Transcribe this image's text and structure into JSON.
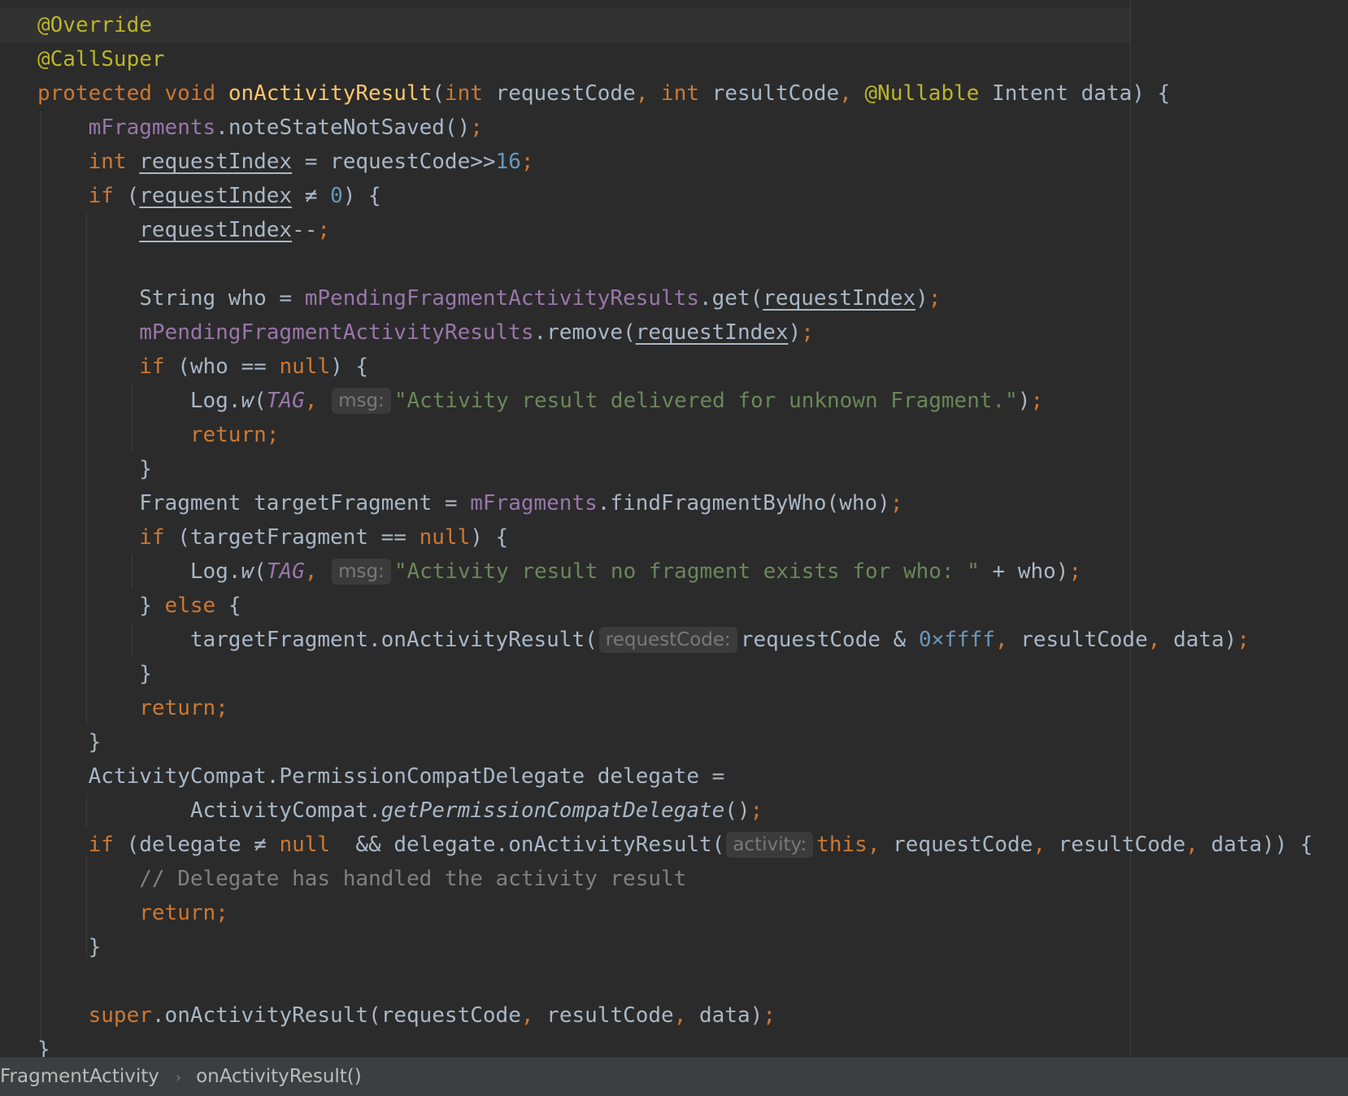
{
  "editor": {
    "lines": [
      [
        {
          "t": "@Override",
          "c": "ann"
        }
      ],
      [
        {
          "t": "@CallSuper",
          "c": "ann"
        }
      ],
      [
        {
          "t": "protected void ",
          "c": "kw"
        },
        {
          "t": "onActivityResult",
          "c": "fn"
        },
        {
          "t": "(",
          "c": "plain"
        },
        {
          "t": "int ",
          "c": "kw"
        },
        {
          "t": "requestCode",
          "c": "plain"
        },
        {
          "t": ", ",
          "c": "punc"
        },
        {
          "t": "int ",
          "c": "kw"
        },
        {
          "t": "resultCode",
          "c": "plain"
        },
        {
          "t": ", ",
          "c": "punc"
        },
        {
          "t": "@Nullable ",
          "c": "ann"
        },
        {
          "t": "Intent data) {",
          "c": "plain"
        }
      ],
      [
        {
          "t": "    ",
          "c": "indent"
        },
        {
          "t": "mFragments",
          "c": "field"
        },
        {
          "t": ".noteStateNotSaved()",
          "c": "plain"
        },
        {
          "t": ";",
          "c": "punc"
        }
      ],
      [
        {
          "t": "    ",
          "c": "indent"
        },
        {
          "t": "int ",
          "c": "kw"
        },
        {
          "t": "requestIndex",
          "c": "var-underline"
        },
        {
          "t": " = requestCode>>",
          "c": "plain"
        },
        {
          "t": "16",
          "c": "num"
        },
        {
          "t": ";",
          "c": "punc"
        }
      ],
      [
        {
          "t": "    ",
          "c": "indent"
        },
        {
          "t": "if ",
          "c": "kw"
        },
        {
          "t": "(",
          "c": "plain"
        },
        {
          "t": "requestIndex",
          "c": "var-underline"
        },
        {
          "t": " ≠ ",
          "c": "plain"
        },
        {
          "t": "0",
          "c": "num"
        },
        {
          "t": ") {",
          "c": "plain"
        }
      ],
      [
        {
          "t": "        ",
          "c": "indent"
        },
        {
          "t": "requestIndex",
          "c": "var-underline"
        },
        {
          "t": "--",
          "c": "plain"
        },
        {
          "t": ";",
          "c": "punc"
        }
      ],
      [],
      [
        {
          "t": "        ",
          "c": "indent"
        },
        {
          "t": "String who = ",
          "c": "plain"
        },
        {
          "t": "mPendingFragmentActivityResults",
          "c": "field"
        },
        {
          "t": ".get(",
          "c": "plain"
        },
        {
          "t": "requestIndex",
          "c": "var-underline"
        },
        {
          "t": ")",
          "c": "plain"
        },
        {
          "t": ";",
          "c": "punc"
        }
      ],
      [
        {
          "t": "        ",
          "c": "indent"
        },
        {
          "t": "mPendingFragmentActivityResults",
          "c": "field"
        },
        {
          "t": ".remove(",
          "c": "plain"
        },
        {
          "t": "requestIndex",
          "c": "var-underline"
        },
        {
          "t": ")",
          "c": "plain"
        },
        {
          "t": ";",
          "c": "punc"
        }
      ],
      [
        {
          "t": "        ",
          "c": "indent"
        },
        {
          "t": "if ",
          "c": "kw"
        },
        {
          "t": "(who == ",
          "c": "plain"
        },
        {
          "t": "null",
          "c": "kw"
        },
        {
          "t": ") {",
          "c": "plain"
        }
      ],
      [
        {
          "t": "            ",
          "c": "indent"
        },
        {
          "t": "Log.",
          "c": "plain"
        },
        {
          "t": "w",
          "c": "static-fn"
        },
        {
          "t": "(",
          "c": "plain"
        },
        {
          "t": "TAG",
          "c": "stat"
        },
        {
          "t": ", ",
          "c": "punc"
        },
        {
          "hint": "msg:"
        },
        {
          "t": "\"Activity result delivered for unknown Fragment.\"",
          "c": "str"
        },
        {
          "t": ")",
          "c": "plain"
        },
        {
          "t": ";",
          "c": "punc"
        }
      ],
      [
        {
          "t": "            ",
          "c": "indent"
        },
        {
          "t": "return;",
          "c": "kw"
        }
      ],
      [
        {
          "t": "        ",
          "c": "indent"
        },
        {
          "t": "}",
          "c": "plain"
        }
      ],
      [
        {
          "t": "        ",
          "c": "indent"
        },
        {
          "t": "Fragment targetFragment = ",
          "c": "plain"
        },
        {
          "t": "mFragments",
          "c": "field"
        },
        {
          "t": ".findFragmentByWho(who)",
          "c": "plain"
        },
        {
          "t": ";",
          "c": "punc"
        }
      ],
      [
        {
          "t": "        ",
          "c": "indent"
        },
        {
          "t": "if ",
          "c": "kw"
        },
        {
          "t": "(targetFragment == ",
          "c": "plain"
        },
        {
          "t": "null",
          "c": "kw"
        },
        {
          "t": ") {",
          "c": "plain"
        }
      ],
      [
        {
          "t": "            ",
          "c": "indent"
        },
        {
          "t": "Log.",
          "c": "plain"
        },
        {
          "t": "w",
          "c": "static-fn"
        },
        {
          "t": "(",
          "c": "plain"
        },
        {
          "t": "TAG",
          "c": "stat"
        },
        {
          "t": ", ",
          "c": "punc"
        },
        {
          "hint": "msg:"
        },
        {
          "t": "\"Activity result no fragment exists for who: \"",
          "c": "str"
        },
        {
          "t": " + who)",
          "c": "plain"
        },
        {
          "t": ";",
          "c": "punc"
        }
      ],
      [
        {
          "t": "        ",
          "c": "indent"
        },
        {
          "t": "} ",
          "c": "plain"
        },
        {
          "t": "else ",
          "c": "kw"
        },
        {
          "t": "{",
          "c": "plain"
        }
      ],
      [
        {
          "t": "            ",
          "c": "indent"
        },
        {
          "t": "targetFragment.onActivityResult(",
          "c": "plain"
        },
        {
          "hint": "requestCode:"
        },
        {
          "t": "requestCode & ",
          "c": "plain"
        },
        {
          "t": "0×ffff",
          "c": "num"
        },
        {
          "t": ", ",
          "c": "punc"
        },
        {
          "t": "resultCode",
          "c": "plain"
        },
        {
          "t": ", ",
          "c": "punc"
        },
        {
          "t": "data)",
          "c": "plain"
        },
        {
          "t": ";",
          "c": "punc"
        }
      ],
      [
        {
          "t": "        ",
          "c": "indent"
        },
        {
          "t": "}",
          "c": "plain"
        }
      ],
      [
        {
          "t": "        ",
          "c": "indent"
        },
        {
          "t": "return;",
          "c": "kw"
        }
      ],
      [
        {
          "t": "    ",
          "c": "indent"
        },
        {
          "t": "}",
          "c": "plain"
        }
      ],
      [
        {
          "t": "    ",
          "c": "indent"
        },
        {
          "t": "ActivityCompat.PermissionCompatDelegate delegate =",
          "c": "plain"
        }
      ],
      [
        {
          "t": "            ",
          "c": "indent"
        },
        {
          "t": "ActivityCompat.",
          "c": "plain"
        },
        {
          "t": "getPermissionCompatDelegate",
          "c": "static-fn"
        },
        {
          "t": "()",
          "c": "plain"
        },
        {
          "t": ";",
          "c": "punc"
        }
      ],
      [
        {
          "t": "    ",
          "c": "indent"
        },
        {
          "t": "if ",
          "c": "kw"
        },
        {
          "t": "(delegate ≠ ",
          "c": "plain"
        },
        {
          "t": "null ",
          "c": "kw"
        },
        {
          "t": " && delegate.onActivityResult(",
          "c": "plain"
        },
        {
          "hint": "activity:"
        },
        {
          "t": "this",
          "c": "kw"
        },
        {
          "t": ", ",
          "c": "punc"
        },
        {
          "t": "requestCode",
          "c": "plain"
        },
        {
          "t": ", ",
          "c": "punc"
        },
        {
          "t": "resultCode",
          "c": "plain"
        },
        {
          "t": ", ",
          "c": "punc"
        },
        {
          "t": "data)) {",
          "c": "plain"
        }
      ],
      [
        {
          "t": "        ",
          "c": "indent"
        },
        {
          "t": "// Delegate has handled the activity result",
          "c": "cmt"
        }
      ],
      [
        {
          "t": "        ",
          "c": "indent"
        },
        {
          "t": "return;",
          "c": "kw"
        }
      ],
      [
        {
          "t": "    ",
          "c": "indent"
        },
        {
          "t": "}",
          "c": "plain"
        }
      ],
      [],
      [
        {
          "t": "    ",
          "c": "indent"
        },
        {
          "t": "super",
          "c": "kw"
        },
        {
          "t": ".onActivityResult(requestCode",
          "c": "plain"
        },
        {
          "t": ", ",
          "c": "punc"
        },
        {
          "t": "resultCode",
          "c": "plain"
        },
        {
          "t": ", ",
          "c": "punc"
        },
        {
          "t": "data)",
          "c": "plain"
        },
        {
          "t": ";",
          "c": "punc"
        }
      ],
      [
        {
          "t": "}",
          "c": "plain"
        }
      ]
    ]
  },
  "breadcrumbs": {
    "items": [
      "FragmentActivity",
      "onActivityResult()"
    ],
    "separator": "›"
  },
  "colors": {
    "background": "#2b2b2b",
    "keyword": "#cc7832",
    "annotation": "#bbb529",
    "method_declaration": "#ffc66d",
    "field": "#9876aa",
    "number": "#6897bb",
    "string": "#6a8759",
    "comment": "#808080",
    "text": "#a9b7c6"
  }
}
